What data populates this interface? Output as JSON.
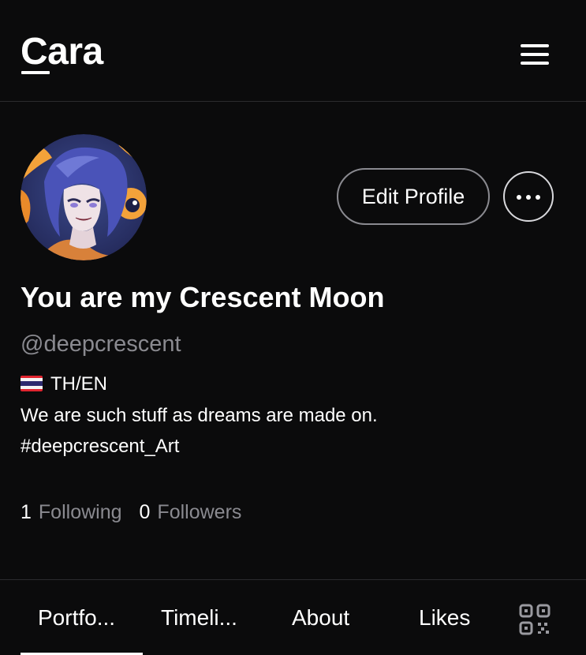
{
  "header": {
    "logo": "Cara",
    "menu_icon": "hamburger-menu-icon"
  },
  "profile": {
    "avatar_alt": "avatar illustration",
    "edit_label": "Edit Profile",
    "more_icon": "more-horizontal-icon",
    "display_name": "You are my Crescent Moon",
    "handle": "@deepcrescent",
    "flag_icon": "thailand-flag-icon",
    "languages": "TH/EN",
    "bio": "We are such stuff as dreams are made on.",
    "hashtag": "#deepcrescent_Art"
  },
  "stats": {
    "following_count": "1",
    "following_label": "Following",
    "followers_count": "0",
    "followers_label": "Followers"
  },
  "tabs": {
    "items": [
      {
        "label": "Portfo..."
      },
      {
        "label": "Timeli..."
      },
      {
        "label": "About"
      },
      {
        "label": "Likes"
      }
    ],
    "active": "Portfo...",
    "qr_icon": "qr-code-icon"
  },
  "colors": {
    "background": "#0b0b0c",
    "text": "#ffffff",
    "muted": "#8a8a90",
    "divider": "#2b2b2e"
  }
}
